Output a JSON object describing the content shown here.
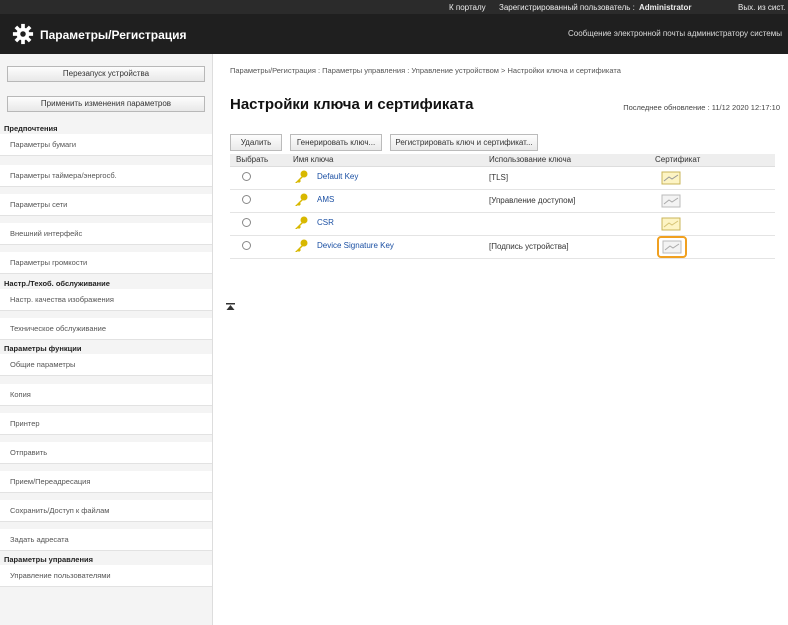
{
  "topbar": {
    "portal": "К порталу",
    "user_label": "Зарегистрированный пользователь :",
    "user_name": "Administrator",
    "logout": "Вых. из сист."
  },
  "header": {
    "title": "Параметры/Регистрация",
    "mail_link": "Сообщение электронной почты администратору системы"
  },
  "sidebar": {
    "restart_button": "Перезапуск устройства",
    "apply_button": "Применить изменения параметров",
    "sections": [
      {
        "title": "Предпочтения",
        "items": [
          "Параметры бумаги",
          "Параметры таймера/энергосб.",
          "Параметры сети",
          "Внешний интерфейс",
          "Параметры громкости"
        ]
      },
      {
        "title": "Настр./Техоб. обслуживание",
        "items": [
          "Настр. качества изображения",
          "Техническое обслуживание"
        ]
      },
      {
        "title": "Параметры функции",
        "items": [
          "Общие параметры",
          "Копия",
          "Принтер",
          "Отправить",
          "Прием/Переадресация",
          "Сохранить/Доступ к файлам"
        ]
      },
      {
        "title": "",
        "items": [
          "Задать адресата"
        ]
      },
      {
        "title": "Параметры управления",
        "items": [
          "Управление пользователями"
        ]
      }
    ]
  },
  "main": {
    "breadcrumb": "Параметры/Регистрация : Параметры управления : Управление устройством > Настройки ключа и сертификата",
    "title": "Настройки ключа и сертификата",
    "last_updated": "Последнее обновление : 11/12 2020 12:17:10",
    "buttons": {
      "delete": "Удалить",
      "generate": "Генерировать ключ...",
      "register": "Регистрировать ключ и сертификат..."
    },
    "table": {
      "headers": [
        "Выбрать",
        "Имя ключа",
        "Использование ключа",
        "Сертификат"
      ],
      "rows": [
        {
          "name": "Default Key",
          "usage": "[TLS]",
          "cert": "certificate-icon"
        },
        {
          "name": "AMS",
          "usage": "[Управление доступом]",
          "cert": "certificate-icon"
        },
        {
          "name": "CSR",
          "usage": "",
          "cert": "certificate-icon"
        },
        {
          "name": "Device Signature Key",
          "usage": "[Подпись устройства]",
          "cert": "certificate-icon",
          "highlighted": true
        }
      ]
    }
  },
  "colors": {
    "topbar": "#2b2b2b",
    "titlebar": "#1f1f1f",
    "link": "#1a4fa3",
    "highlight": "#f0a020",
    "key_icon": "#d8b800"
  }
}
